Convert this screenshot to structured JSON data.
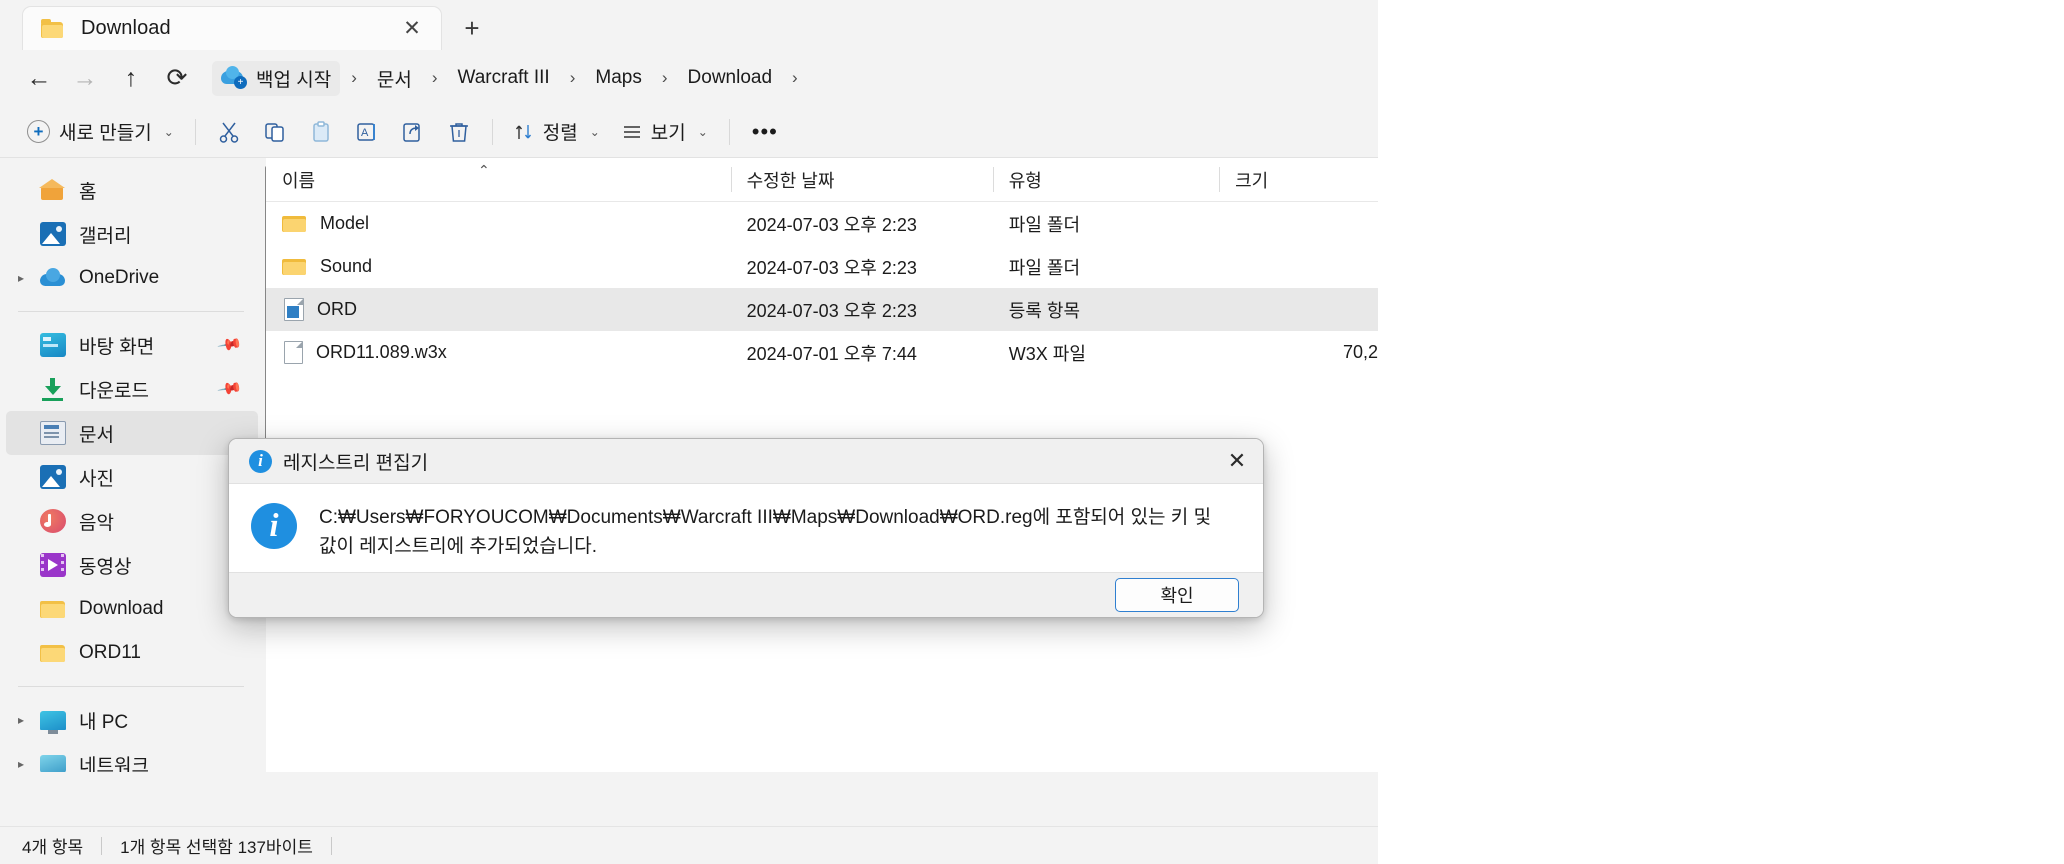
{
  "window": {
    "tab": {
      "label": "Download",
      "icon": "folder-icon",
      "close_label": "✕"
    },
    "new_tab_label": "+"
  },
  "nav": {
    "back": "←",
    "forward": "→",
    "up": "↑",
    "refresh": "⟳"
  },
  "breadcrumb": {
    "items": [
      {
        "label": "백업 시작",
        "icon": "onedrive-backup-icon"
      },
      {
        "label": "문서"
      },
      {
        "label": "Warcraft III"
      },
      {
        "label": "Maps"
      },
      {
        "label": "Download"
      }
    ],
    "separator": "›"
  },
  "toolbar": {
    "new_label": "새로 만들기",
    "cut_label": "✂",
    "copy_label": "❐",
    "paste_label": "Ὄb",
    "rename_label": "A",
    "share_label": "↪",
    "delete_label": "Ὕ1",
    "sort_label": "정렬",
    "view_label": "보기",
    "more_label": "•••",
    "chevron": "⌄"
  },
  "sidebar": {
    "items": [
      {
        "label": "홈",
        "icon": "home-icon",
        "indent": false,
        "expand": false,
        "pin": false,
        "selected": false
      },
      {
        "label": "갤러리",
        "icon": "gallery-icon",
        "indent": false,
        "expand": false,
        "pin": false,
        "selected": false
      },
      {
        "label": "OneDrive",
        "icon": "onedrive-icon",
        "indent": false,
        "expand": true,
        "pin": false,
        "selected": false
      },
      {
        "label": "바탕 화면",
        "icon": "desktop-icon",
        "indent": false,
        "expand": false,
        "pin": true,
        "selected": false
      },
      {
        "label": "다운로드",
        "icon": "downloads-icon",
        "indent": false,
        "expand": false,
        "pin": true,
        "selected": false
      },
      {
        "label": "문서",
        "icon": "documents-icon",
        "indent": false,
        "expand": false,
        "pin": true,
        "selected": true
      },
      {
        "label": "사진",
        "icon": "pictures-icon",
        "indent": false,
        "expand": false,
        "pin": false,
        "selected": false
      },
      {
        "label": "음악",
        "icon": "music-icon",
        "indent": false,
        "expand": false,
        "pin": false,
        "selected": false
      },
      {
        "label": "동영상",
        "icon": "videos-icon",
        "indent": false,
        "expand": false,
        "pin": false,
        "selected": false
      },
      {
        "label": "Download",
        "icon": "folder-icon",
        "indent": false,
        "expand": false,
        "pin": false,
        "selected": false
      },
      {
        "label": "ORD11",
        "icon": "folder-icon",
        "indent": false,
        "expand": false,
        "pin": false,
        "selected": false
      },
      {
        "label": "내 PC",
        "icon": "this-pc-icon",
        "indent": false,
        "expand": true,
        "pin": false,
        "selected": false
      },
      {
        "label": "네트워크",
        "icon": "network-icon",
        "indent": false,
        "expand": true,
        "pin": false,
        "selected": false
      }
    ]
  },
  "file_list": {
    "columns": [
      "이름",
      "수정한 날짜",
      "유형",
      "크기"
    ],
    "sort_indicator": "⌃",
    "rows": [
      {
        "name": "Model",
        "date": "2024-07-03 오후 2:23",
        "type": "파일 폴더",
        "size": "",
        "icon": "folder-icon",
        "selected": false
      },
      {
        "name": "Sound",
        "date": "2024-07-03 오후 2:23",
        "type": "파일 폴더",
        "size": "",
        "icon": "folder-icon",
        "selected": false
      },
      {
        "name": "ORD",
        "date": "2024-07-03 오후 2:23",
        "type": "등록 항목",
        "size": "",
        "icon": "registry-file-icon",
        "selected": true
      },
      {
        "name": "ORD11.089.w3x",
        "date": "2024-07-01 오후 7:44",
        "type": "W3X 파일",
        "size": "70,2",
        "icon": "generic-file-icon",
        "selected": false
      }
    ]
  },
  "status_bar": {
    "item_count": "4개 항목",
    "selection": "1개 항목 선택함 137바이트"
  },
  "dialog": {
    "title": "레지스트리 편집기",
    "close_label": "✕",
    "info_glyph": "i",
    "message": "C:₩Users₩FORYOUCOM₩Documents₩Warcraft III₩Maps₩Download₩ORD.reg에 포함되어 있는 키 및 값이 레지스트리에 추가되었습니다.",
    "ok_label": "확인"
  },
  "colors": {
    "accent": "#2f7fd0",
    "info_blue": "#1f8fe0",
    "folder_yellow": "#f2c046",
    "selection_gray": "#e8e8e8"
  }
}
